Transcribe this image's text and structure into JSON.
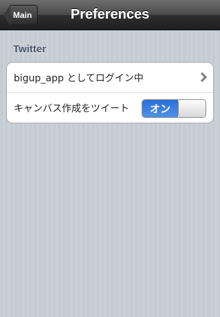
{
  "navbar": {
    "back_label": "Main",
    "title": "Preferences"
  },
  "twitter_section": {
    "header": "Twitter",
    "login_row": {
      "label": "bigup_app としてログイン中"
    },
    "tweet_row": {
      "label": "キャンバス作成をツイート",
      "toggle_label": "オン",
      "toggle_state": "on"
    }
  }
}
